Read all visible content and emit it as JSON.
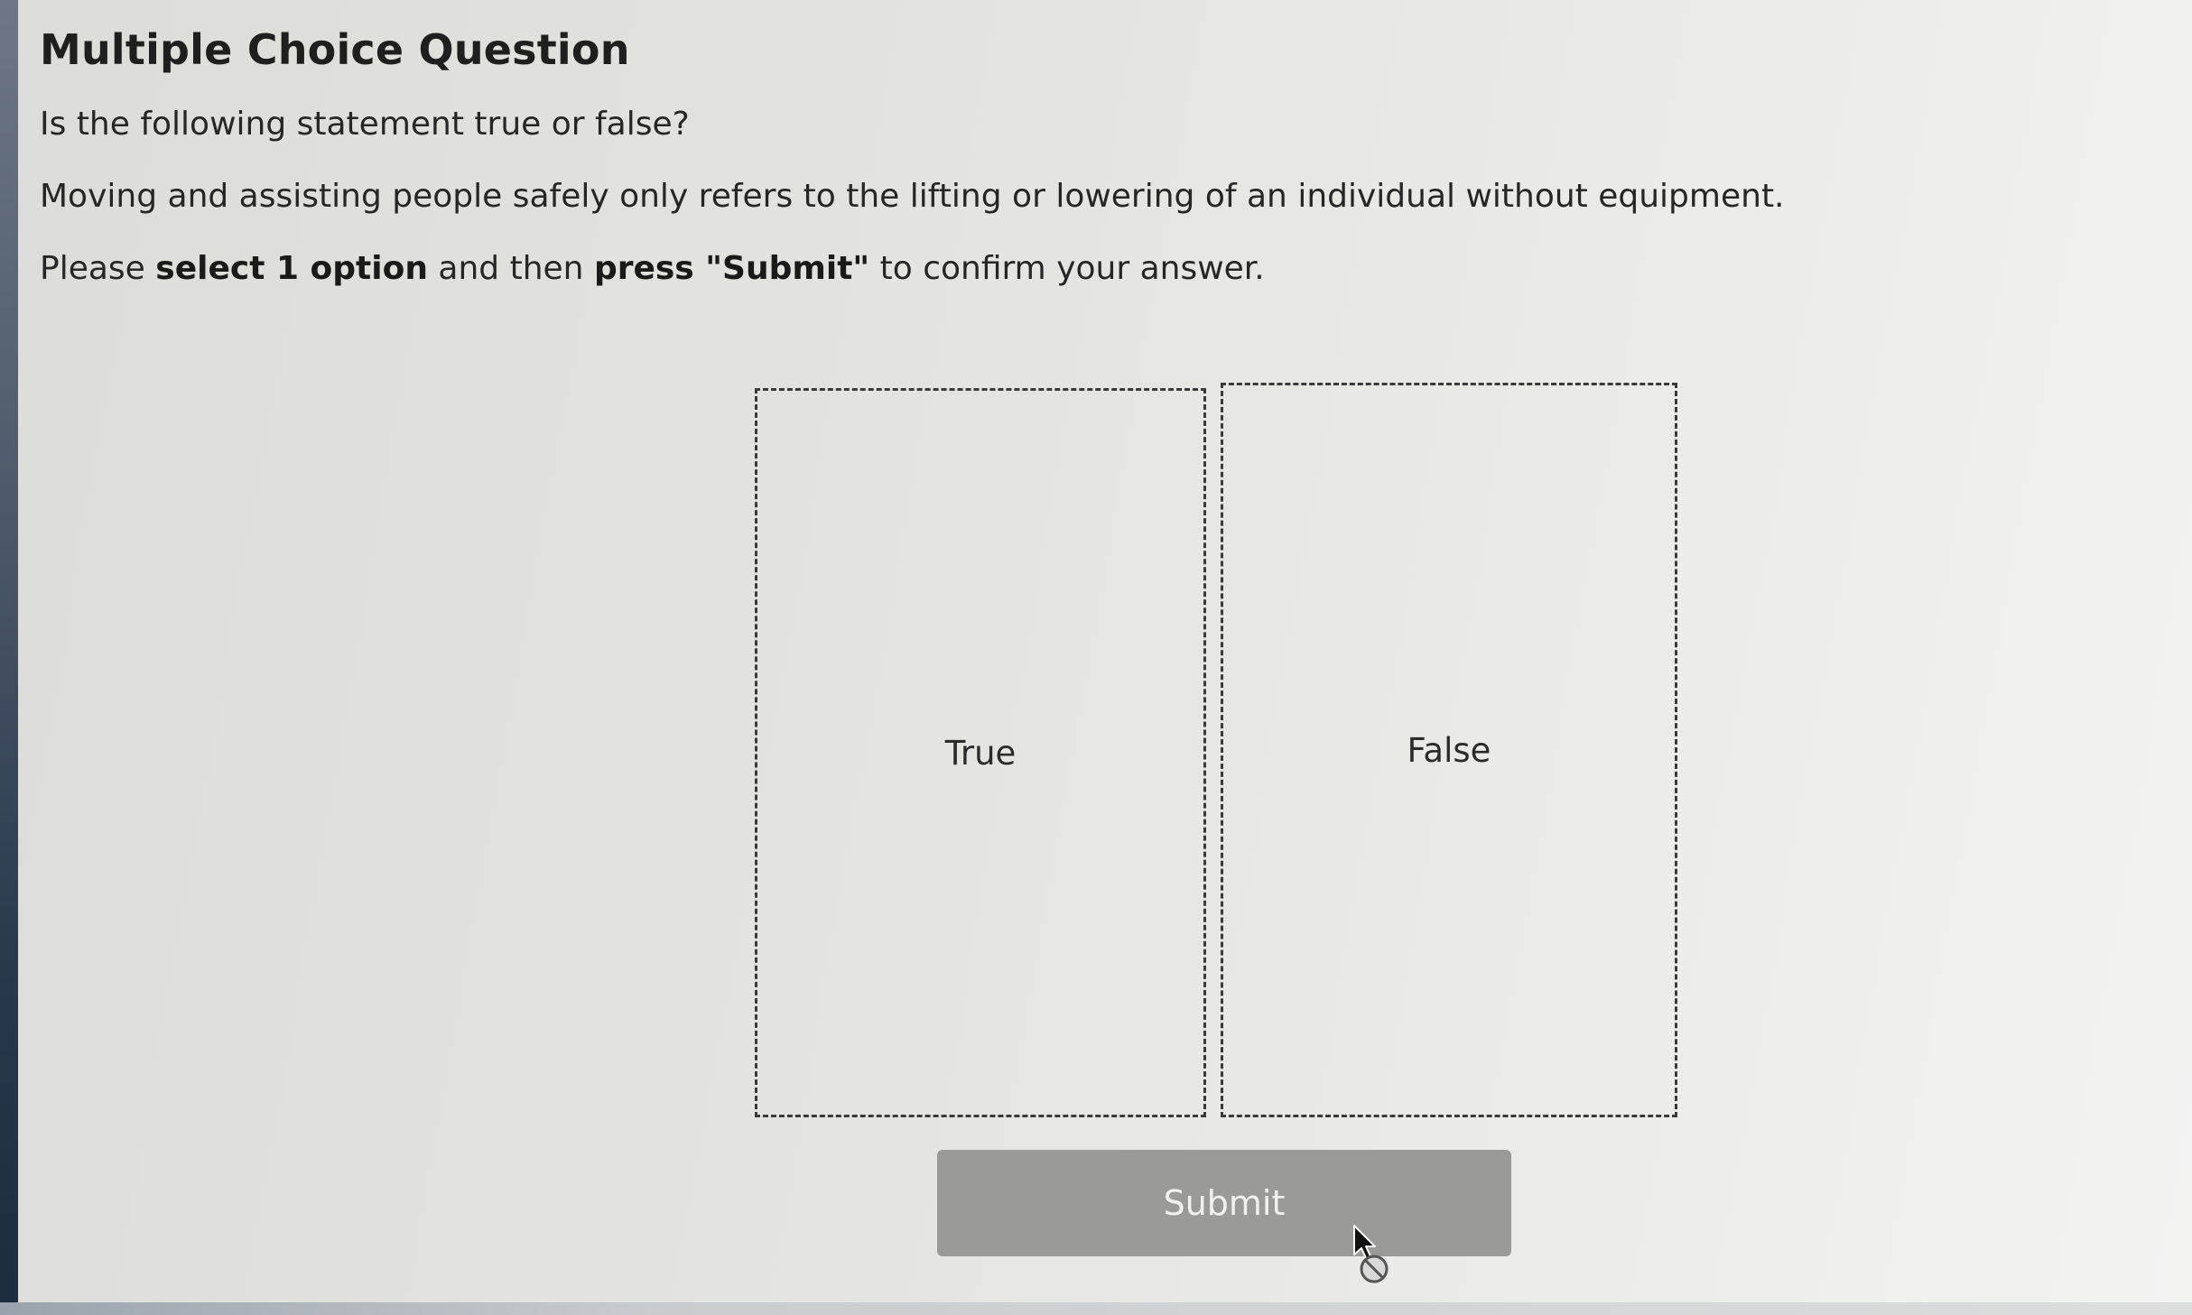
{
  "question": {
    "title": "Multiple Choice Question",
    "prompt": "Is the following statement true or false?",
    "statement": "Moving and assisting people safely only refers to the lifting or lowering of an individual without equipment.",
    "instruction": {
      "part1": "Please ",
      "bold1": "select 1 option",
      "part2": " and then ",
      "bold2": "press \"Submit\"",
      "part3": " to confirm your answer."
    }
  },
  "options": [
    {
      "label": "True"
    },
    {
      "label": "False"
    }
  ],
  "submit": {
    "label": "Submit",
    "state": "disabled"
  },
  "cursor": {
    "icon": "not-allowed-cursor-icon"
  },
  "colors": {
    "submit_bg": "#9a9a98",
    "option_border": "#3a3a3a"
  }
}
